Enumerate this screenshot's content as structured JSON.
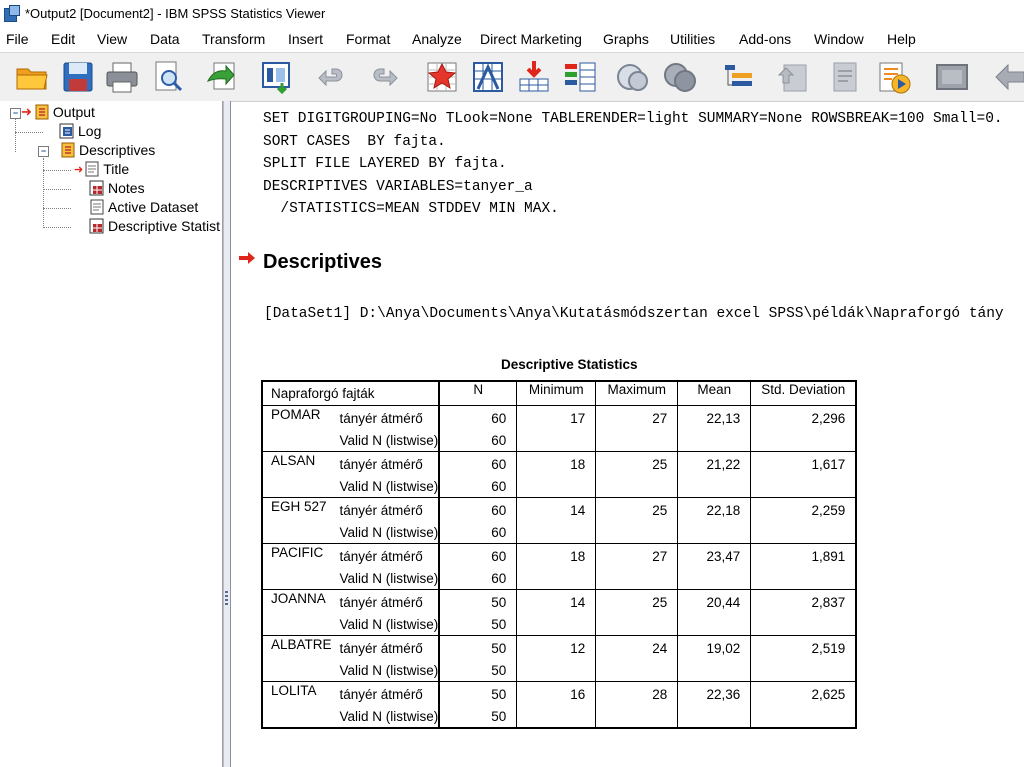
{
  "window": {
    "title": "*Output2 [Document2] - IBM SPSS Statistics Viewer"
  },
  "menu": [
    "File",
    "Edit",
    "View",
    "Data",
    "Transform",
    "Insert",
    "Format",
    "Analyze",
    "Direct Marketing",
    "Graphs",
    "Utilities",
    "Add-ons",
    "Window",
    "Help"
  ],
  "toolbar": [
    "open-icon",
    "save-icon",
    "print-icon",
    "print-preview-icon",
    "export-icon",
    "recall-dialog-icon",
    "undo-icon",
    "redo-icon",
    "goto-case-icon",
    "goto-variable-icon",
    "insert-cases-icon",
    "variables-icon",
    "split-file-icon",
    "select-cases-icon",
    "designate-window-icon",
    "promote-icon",
    "demote-icon",
    "run-script-icon",
    "hide-icon",
    "collapse-icon"
  ],
  "outline": {
    "output": "Output",
    "log": "Log",
    "descriptives": "Descriptives",
    "title": "Title",
    "notes": "Notes",
    "active_dataset": "Active Dataset",
    "descriptive_statistics": "Descriptive Statist"
  },
  "syntax": [
    "SET DIGITGROUPING=No TLook=None TABLERENDER=light SUMMARY=None ROWSBREAK=100 Small=0.",
    "SORT CASES  BY fajta.",
    "SPLIT FILE LAYERED BY fajta.",
    "DESCRIPTIVES VARIABLES=tanyer_a",
    "  /STATISTICS=MEAN STDDEV MIN MAX."
  ],
  "heading": "Descriptives",
  "dataset_line": "[DataSet1] D:\\Anya\\Documents\\Anya\\Kutatásmódszertan excel SPSS\\példák\\Napraforgó tány",
  "table": {
    "title": "Descriptive Statistics",
    "group_header": "Napraforgó fajták",
    "columns": [
      "N",
      "Minimum",
      "Maximum",
      "Mean",
      "Std. Deviation"
    ],
    "var_label": "tányér átmérő",
    "valid_label": "Valid N (listwise)",
    "rows": [
      {
        "group": "POMAR",
        "n": "60",
        "min": "17",
        "max": "27",
        "mean": "22,13",
        "sd": "2,296",
        "valid_n": "60"
      },
      {
        "group": "ALSAN",
        "n": "60",
        "min": "18",
        "max": "25",
        "mean": "21,22",
        "sd": "1,617",
        "valid_n": "60"
      },
      {
        "group": "EGH 527",
        "n": "60",
        "min": "14",
        "max": "25",
        "mean": "22,18",
        "sd": "2,259",
        "valid_n": "60"
      },
      {
        "group": "PACIFIC",
        "n": "60",
        "min": "18",
        "max": "27",
        "mean": "23,47",
        "sd": "1,891",
        "valid_n": "60"
      },
      {
        "group": "JOANNA",
        "n": "50",
        "min": "14",
        "max": "25",
        "mean": "20,44",
        "sd": "2,837",
        "valid_n": "50"
      },
      {
        "group": "ALBATRE",
        "n": "50",
        "min": "12",
        "max": "24",
        "mean": "19,02",
        "sd": "2,519",
        "valid_n": "50"
      },
      {
        "group": "LOLITA",
        "n": "50",
        "min": "16",
        "max": "28",
        "mean": "22,36",
        "sd": "2,625",
        "valid_n": "50"
      }
    ]
  },
  "colors": {
    "accent_red": "#e0261b",
    "tree_line": "#808080"
  }
}
